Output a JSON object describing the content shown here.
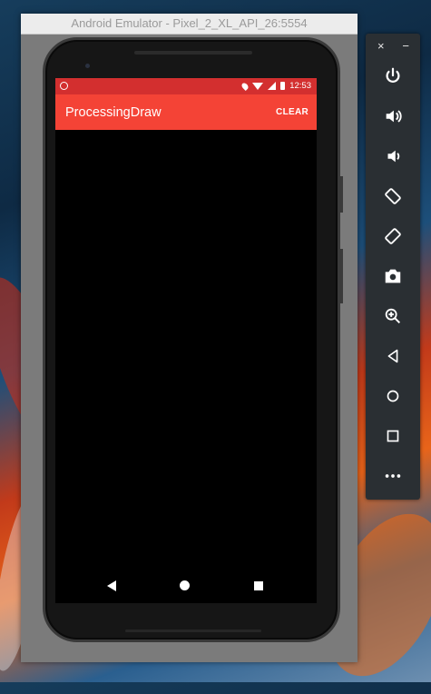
{
  "window": {
    "title": "Android Emulator - Pixel_2_XL_API_26:5554"
  },
  "status_bar": {
    "time": "12:53"
  },
  "app_bar": {
    "title": "ProcessingDraw",
    "action": "CLEAR"
  },
  "toolbar": {
    "close": "×",
    "minimize": "−",
    "items": [
      {
        "name": "power",
        "icon": "power-icon"
      },
      {
        "name": "volume-up",
        "icon": "volume-up-icon"
      },
      {
        "name": "volume-down",
        "icon": "volume-down-icon"
      },
      {
        "name": "rotate-left",
        "icon": "rotate-left-icon"
      },
      {
        "name": "rotate-right",
        "icon": "rotate-right-icon"
      },
      {
        "name": "screenshot",
        "icon": "camera-icon"
      },
      {
        "name": "zoom",
        "icon": "zoom-in-icon"
      },
      {
        "name": "back",
        "icon": "back-icon"
      },
      {
        "name": "home",
        "icon": "home-icon"
      },
      {
        "name": "overview",
        "icon": "overview-icon"
      },
      {
        "name": "more",
        "icon": "more-icon"
      }
    ]
  },
  "colors": {
    "status_bar": "#d32f2f",
    "app_bar": "#f44336",
    "toolbar": "#2a2f33"
  }
}
